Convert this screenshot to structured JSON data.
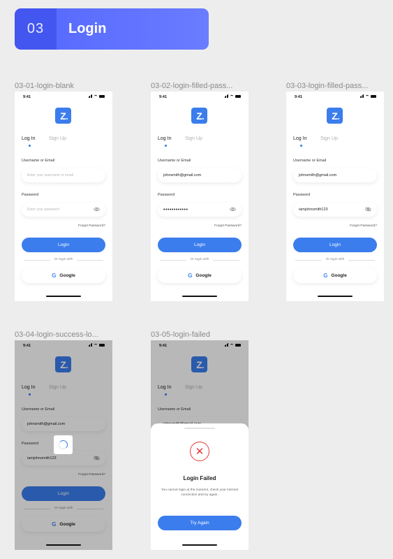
{
  "header": {
    "number": "03",
    "title": "Login"
  },
  "frame_labels": [
    "03-01-login-blank",
    "03-02-login-filled-pass...",
    "03-03-login-filled-pass...",
    "03-04-login-success-lo...",
    "03-05-login-failed"
  ],
  "status": {
    "time": "9:41"
  },
  "logo": {
    "letter": "Z"
  },
  "tabs": {
    "login": "Log In",
    "signup": "Sign Up"
  },
  "form": {
    "username_label": "Username or Email",
    "username_placeholder": "Enter your username or email",
    "username_value": "johnsmith@gmail.com",
    "password_label": "Password",
    "password_placeholder": "Enter your password",
    "password_masked": "••••••••••••",
    "password_value": "iamjohnsmith123",
    "forgot": "Forget Password?",
    "login_button": "Login",
    "or_text": "Or login with",
    "google_button": "Google",
    "google_glyph": "G"
  },
  "failed_sheet": {
    "error_glyph": "✕",
    "title": "Login Failed",
    "description": "You cannot login at the moment, check your internet connection and try again.",
    "retry_button": "Try Again"
  },
  "colors": {
    "accent": "#3b7ded",
    "header": "#5467ff",
    "error": "#e53935"
  }
}
